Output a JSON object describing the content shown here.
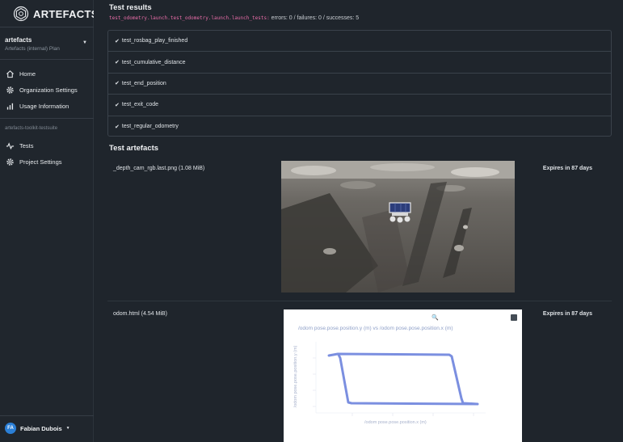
{
  "app": {
    "name": "ARTEFACTS"
  },
  "org": {
    "name": "artefacts",
    "plan": "Artefacts (internal) Plan"
  },
  "nav": {
    "home": "Home",
    "org_settings": "Organization Settings",
    "usage": "Usage Information",
    "section": "artefacts-toolkit-testsuite",
    "tests": "Tests",
    "project_settings": "Project Settings"
  },
  "user": {
    "initials": "FA",
    "name": "Fabian Dubois"
  },
  "results": {
    "heading": "Test results",
    "suite": "test_odometry.launch.test_odometry.launch.launch_tests:",
    "stats": "errors: 0 / failures: 0 / successes: 5",
    "tests": [
      "test_rosbag_play_finished",
      "test_cumulative_distance",
      "test_end_position",
      "test_exit_code",
      "test_regular_odometry"
    ]
  },
  "artefacts": {
    "heading": "Test artefacts",
    "items": [
      {
        "label": "_depth_cam_rgb.last.png (1.08 MiB)",
        "expires": "Expires in 87 days"
      },
      {
        "label": "odom.html (4.54 MiB)",
        "expires": "Expires in 87 days"
      }
    ]
  },
  "plot": {
    "title": "/odom pose.pose.position.y (m) vs /odom pose.pose.position.x (m)",
    "xlabel": "/odom pose.pose.position.x (m)",
    "ylabel": "/odom pose.pose.position.y (m)",
    "line_color": "#7b8fe0"
  },
  "colors": {
    "accent": "#e86da8",
    "avatar": "#2b7fd6"
  }
}
